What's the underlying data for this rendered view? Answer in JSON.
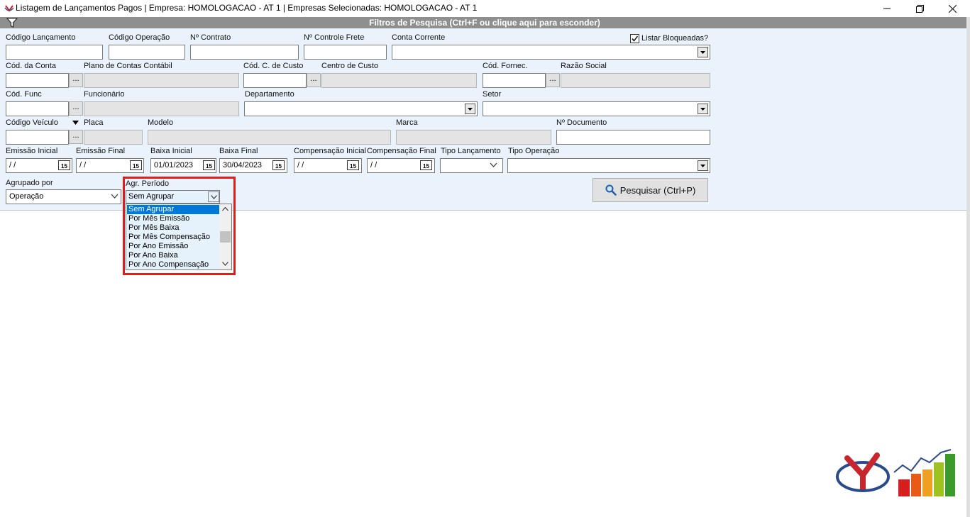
{
  "window": {
    "title": "Listagem de Lançamentos Pagos | Empresa: HOMOLOGACAO - AT 1 | Empresas Selecionadas: HOMOLOGACAO - AT 1"
  },
  "filters": {
    "bar_title": "Filtros de Pesquisa (Ctrl+F ou clique aqui para esconder)",
    "listar_bloqueadas": "Listar Bloqueadas?",
    "labels": {
      "codigo_lancamento": "Código Lançamento",
      "codigo_operacao": "Código Operação",
      "n_contrato": "Nº Contrato",
      "n_controle_frete": "Nº Controle Frete",
      "conta_corrente": "Conta Corrente",
      "cod_conta": "Cód. da Conta",
      "plano_contas": "Plano de Contas Contábil",
      "cod_c_custo": "Cód. C. de Custo",
      "centro_custo": "Centro de Custo",
      "cod_fornec": "Cód. Fornec.",
      "razao_social": "Razão Social",
      "cod_func": "Cód. Func",
      "funcionario": "Funcionário",
      "departamento": "Departamento",
      "setor": "Setor",
      "codigo_veiculo": "Código Veículo",
      "placa": "Placa",
      "modelo": "Modelo",
      "marca": "Marca",
      "n_documento": "Nº Documento",
      "emissao_inicial": "Emissão Inicial",
      "emissao_final": "Emissão Final",
      "baixa_inicial": "Baixa Inicial",
      "baixa_final": "Baixa Final",
      "compensacao_inicial": "Compensação Inicial",
      "compensacao_final": "Compensação Final",
      "tipo_lancamento": "Tipo Lançamento",
      "tipo_operacao": "Tipo Operação",
      "agrupado_por": "Agrupado por",
      "agr_periodo": "Agr. Período"
    },
    "values": {
      "emissao_inicial": " /  /",
      "emissao_final": " /  /",
      "baixa_inicial": "01/01/2023",
      "baixa_final": "30/04/2023",
      "compensacao_inicial": " /  /",
      "compensacao_final": " /  /",
      "agrupado_por": "Operação",
      "agr_periodo": "Sem Agrupar"
    },
    "dots": "...",
    "cal_glyph": "15",
    "agr_periodo_options": [
      "Sem Agrupar",
      "Por Mês Emissão",
      "Por Mês Baixa",
      "Por Mês Compensação",
      "Por Ano Emissão",
      "Por Ano Baixa",
      "Por Ano Compensação"
    ],
    "search_button": "Pesquisar (Ctrl+P)"
  },
  "colors": {
    "panel_bg": "#eaf3fc",
    "filter_bar": "#8f8f8f",
    "highlight": "#e31b1b",
    "selection": "#0078d7"
  }
}
